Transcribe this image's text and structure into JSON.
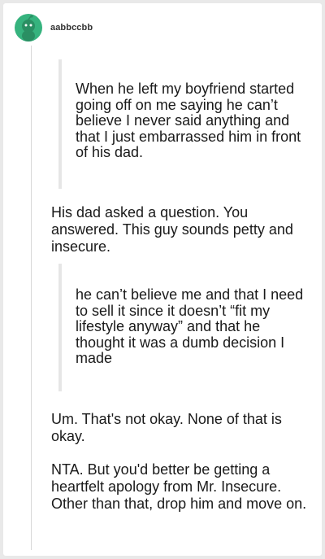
{
  "post": {
    "username": "aabbccbb",
    "quote1": "When he left my boyfriend started going off on me saying he can’t believe I never said anything and that I just embarrassed him in front of his dad.",
    "reply1": "His dad asked a question. You answered. This guy sounds petty and insecure.",
    "quote2": "he can’t believe me and that I need to sell it since it doesn’t “fit my lifestyle anyway” and that he thought it was a dumb decision I made",
    "reply2": "Um. That's not okay. None of that is okay.",
    "reply3": "NTA. But you'd better be getting a heartfelt apology from Mr. Insecure. Other than that, drop him and move on."
  },
  "colors": {
    "avatar": "#36b37e",
    "text": "#1a1a1a",
    "quote_bar": "#e6e6e6"
  },
  "icons": {
    "avatar": "snoo-avatar-icon"
  }
}
